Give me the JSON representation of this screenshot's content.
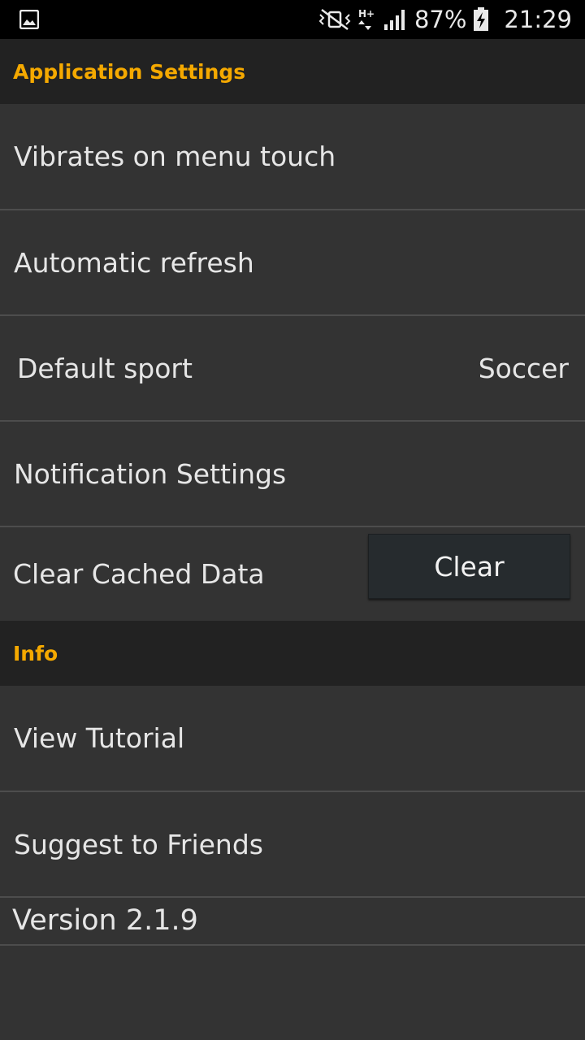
{
  "status_bar": {
    "battery": "87%",
    "time": "21:29",
    "icons": [
      "image-notification-icon",
      "vibrate-mode-icon",
      "hplus-data-icon",
      "signal-strength-icon",
      "battery-charging-icon"
    ]
  },
  "sections": {
    "app_settings": {
      "title": "Application Settings",
      "items": {
        "vibrates": "Vibrates on menu touch",
        "auto_refresh": "Automatic refresh",
        "default_sport": {
          "label": "Default sport",
          "value": "Soccer"
        },
        "notifications": "Notification Settings",
        "clear_cache": {
          "label": "Clear Cached Data",
          "button": "Clear"
        }
      }
    },
    "info": {
      "title": "Info",
      "items": {
        "tutorial": "View Tutorial",
        "suggest": "Suggest to Friends"
      }
    }
  },
  "version": "Version 2.1.9",
  "colors": {
    "accent": "#f5a900",
    "background": "#333333",
    "header_background": "#222222",
    "divider": "#4d4d4d"
  }
}
